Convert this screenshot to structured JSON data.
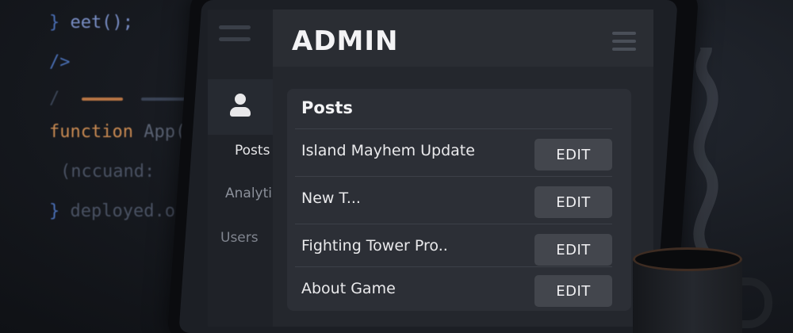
{
  "background_code": {
    "line1": {
      "brace": "}",
      "text": "eet();"
    },
    "line2": {
      "text": "/>"
    },
    "line3": {
      "text": "/"
    },
    "line4": {
      "keyword": "function",
      "text": "App()"
    },
    "line5": {
      "text": "(nccuand:"
    },
    "line6": {
      "brace": "}",
      "text": "deployed.ocs"
    }
  },
  "app": {
    "title": "ADMIN"
  },
  "sidebar": {
    "items": [
      {
        "label": "Posts",
        "active": true
      },
      {
        "label": "Analytics",
        "active": false
      },
      {
        "label": "Users",
        "active": false
      }
    ]
  },
  "posts_card": {
    "title": "Posts",
    "rows": [
      {
        "title": "Island Mayhem Update",
        "action": "EDIT"
      },
      {
        "title": "New T...",
        "action": "EDIT"
      },
      {
        "title": "Fighting Tower Pro..",
        "action": "EDIT"
      },
      {
        "title": "About Game",
        "action": "EDIT"
      }
    ]
  },
  "colors": {
    "background": "#14171d",
    "panel": "#24272d",
    "card": "#2c2f36",
    "button": "#43464d",
    "accent_code": "#c98a52"
  },
  "icons": {
    "user": "user-icon",
    "hamburger": "hamburger-icon",
    "menu": "menu-icon"
  }
}
